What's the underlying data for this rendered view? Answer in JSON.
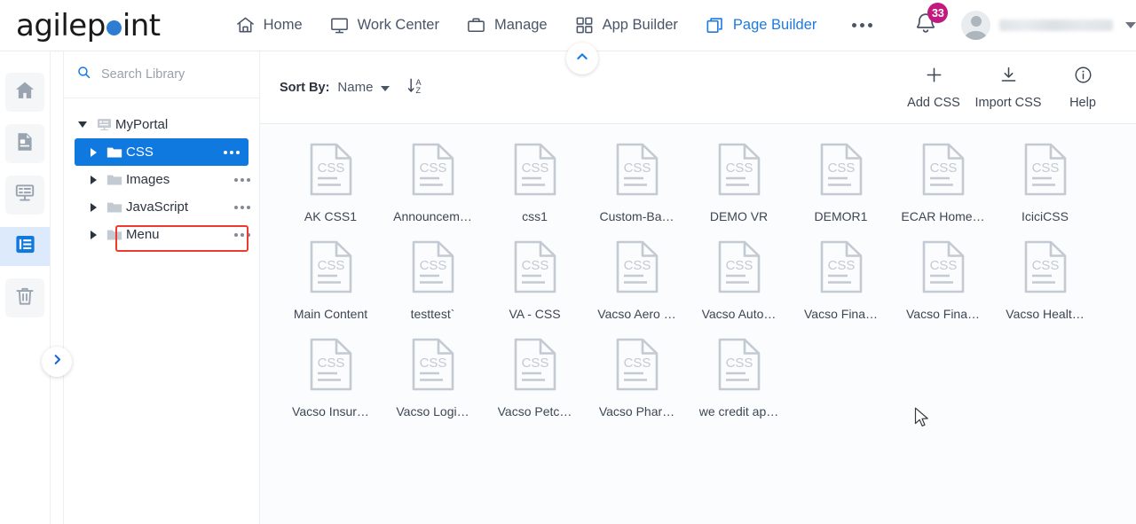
{
  "brand": {
    "name_before": "agilep",
    "name_after": "int",
    "dot_color": "#2e7dd1"
  },
  "topnav": {
    "items": [
      {
        "label": "Home",
        "icon": "home-icon",
        "active": false
      },
      {
        "label": "Work Center",
        "icon": "monitor-icon",
        "active": false
      },
      {
        "label": "Manage",
        "icon": "briefcase-icon",
        "active": false
      },
      {
        "label": "App Builder",
        "icon": "grid-squares-icon",
        "active": false
      },
      {
        "label": "Page Builder",
        "icon": "copy-pages-icon",
        "active": true
      }
    ],
    "overflow_label": "more-options",
    "notification_count": "33",
    "user_name": "",
    "active_color": "#1f7ae0"
  },
  "rail": {
    "items": [
      {
        "name": "home",
        "icon": "home-icon",
        "active": false
      },
      {
        "name": "pages",
        "icon": "page-document-icon",
        "active": false
      },
      {
        "name": "forms",
        "icon": "form-layout-icon",
        "active": false
      },
      {
        "name": "library",
        "icon": "library-list-icon",
        "active": true
      },
      {
        "name": "recycle-bin",
        "icon": "trash-icon",
        "active": false
      }
    ],
    "expand_label": "expand-panel"
  },
  "library": {
    "search": {
      "placeholder": "Search Library",
      "value": ""
    },
    "tree": [
      {
        "label": "MyPortal",
        "icon": "portal-monitor-icon",
        "level": 0,
        "expanded": true,
        "selected": false,
        "has_menu": false
      },
      {
        "label": "CSS",
        "icon": "folder-icon",
        "level": 1,
        "expanded": false,
        "selected": true,
        "has_menu": true
      },
      {
        "label": "Images",
        "icon": "folder-icon",
        "level": 1,
        "expanded": false,
        "selected": false,
        "has_menu": true
      },
      {
        "label": "JavaScript",
        "icon": "folder-icon",
        "level": 1,
        "expanded": false,
        "selected": false,
        "has_menu": true,
        "highlighted": true
      },
      {
        "label": "Menu",
        "icon": "folder-icon",
        "level": 1,
        "expanded": false,
        "selected": false,
        "has_menu": true
      }
    ],
    "highlight_color": "#ef3b2d"
  },
  "toolbar": {
    "sort_label": "Sort By:",
    "sort_value": "Name",
    "sort_direction_icon": "sort-a-z-icon",
    "actions": [
      {
        "label": "Add CSS",
        "icon": "plus-icon"
      },
      {
        "label": "Import CSS",
        "icon": "download-icon"
      },
      {
        "label": "Help",
        "icon": "info-circle-icon"
      }
    ]
  },
  "files": {
    "icon_type": "css-file-icon",
    "icon_text": "CSS",
    "items": [
      {
        "name": "AK CSS1"
      },
      {
        "name": "Announcem…"
      },
      {
        "name": "css1"
      },
      {
        "name": "Custom-Ba…"
      },
      {
        "name": "DEMO VR"
      },
      {
        "name": "DEMOR1"
      },
      {
        "name": "ECAR Home…"
      },
      {
        "name": "IciciCSS"
      },
      {
        "name": "Main Content"
      },
      {
        "name": "testtest`"
      },
      {
        "name": "VA - CSS"
      },
      {
        "name": "Vacso Aero …"
      },
      {
        "name": "Vacso Auto…"
      },
      {
        "name": "Vacso Fina…"
      },
      {
        "name": "Vacso Fina…"
      },
      {
        "name": "Vacso Healt…"
      },
      {
        "name": "Vacso Insur…"
      },
      {
        "name": "Vacso Logi…"
      },
      {
        "name": "Vacso Petc…"
      },
      {
        "name": "Vacso Phar…"
      },
      {
        "name": "we credit ap…"
      }
    ]
  },
  "collapse_button": {
    "name": "collapse-header",
    "icon": "chevron-up-icon"
  }
}
